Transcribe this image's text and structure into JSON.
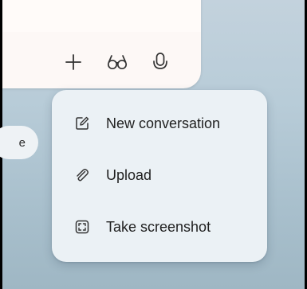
{
  "compose": {
    "toolbar": {
      "add_icon": "plus-icon",
      "glasses_icon": "glasses-icon",
      "mic_icon": "microphone-icon"
    }
  },
  "background_pill": {
    "label": "e"
  },
  "menu": {
    "items": [
      {
        "label": "New conversation",
        "icon": "new-conversation-icon"
      },
      {
        "label": "Upload",
        "icon": "paperclip-icon"
      },
      {
        "label": "Take screenshot",
        "icon": "screenshot-icon"
      }
    ]
  },
  "colors": {
    "menu_background": "#ebf1f5",
    "compose_background": "#fdf8f6",
    "text": "#1f1f1f",
    "icon": "#333333"
  }
}
